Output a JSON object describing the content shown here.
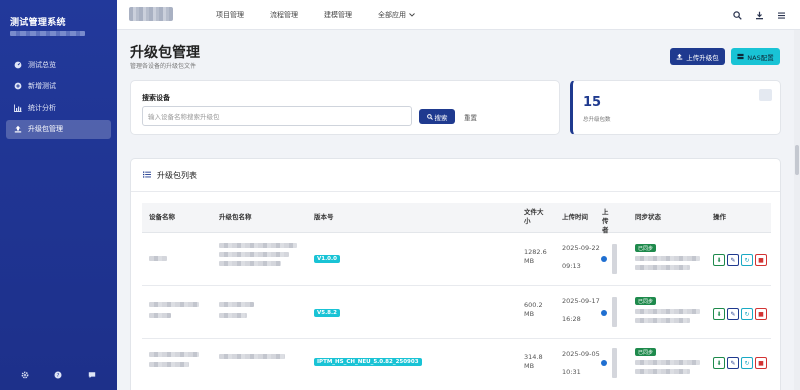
{
  "app": {
    "title": "测试管理系统"
  },
  "sidebar": {
    "items": [
      {
        "label": "测试总览",
        "icon": "dashboard-icon"
      },
      {
        "label": "新增测试",
        "icon": "add-circle-icon"
      },
      {
        "label": "统计分析",
        "icon": "chart-icon"
      },
      {
        "label": "升级包管理",
        "icon": "upload-icon",
        "active": true
      }
    ],
    "footer_icons": [
      "settings-icon",
      "help-icon",
      "chat-icon"
    ]
  },
  "topbar": {
    "nav": [
      "项目管理",
      "流程管理",
      "建模管理",
      "全部应用"
    ],
    "actions": [
      "search-icon",
      "download-icon",
      "menu-icon"
    ]
  },
  "page": {
    "title": "升级包管理",
    "subtitle": "管理各设备的升级包文件",
    "upload_button": "上传升级包",
    "nas_button": "NAS配置"
  },
  "search": {
    "label": "搜索设备",
    "placeholder": "输入设备名称搜索升级包",
    "search_button": "搜索",
    "reset_button": "重置"
  },
  "stats": {
    "count": "15",
    "label": "总升级包数"
  },
  "list": {
    "title": "升级包列表",
    "columns": [
      "设备名称",
      "升级包名称",
      "版本号",
      "文件大小",
      "上传时间",
      "上传者",
      "同步状态",
      "操作"
    ],
    "rows": [
      {
        "version": "V1.0.0",
        "size": "1282.6 MB",
        "date": "2025-09-22",
        "time": "09:13",
        "sync": "已同步"
      },
      {
        "version": "V5.8.2",
        "size": "600.2 MB",
        "date": "2025-09-17",
        "time": "16:28",
        "sync": "已同步"
      },
      {
        "version": "IPTM_HS_CH_NEU_5.0.82_250903",
        "size": "314.8 MB",
        "date": "2025-09-05",
        "time": "10:31",
        "sync": "已同步"
      }
    ]
  },
  "colors": {
    "sidebar": "#22399b",
    "primary": "#1f3a8f",
    "accent": "#19c3d5",
    "success": "#1e8a4c",
    "danger": "#d23333"
  }
}
